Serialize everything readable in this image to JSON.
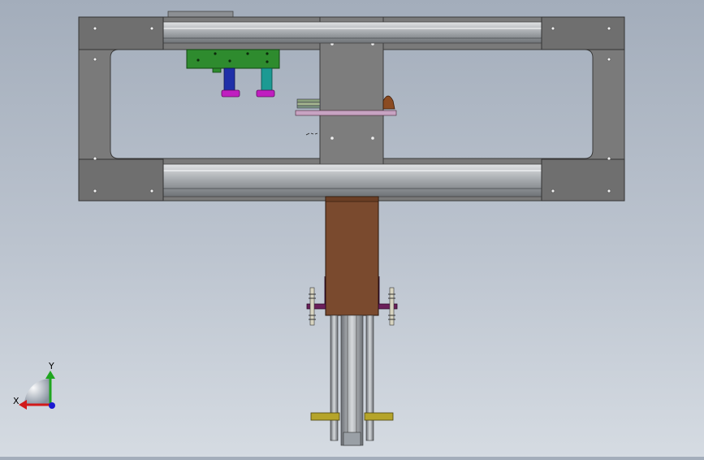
{
  "viewport": {
    "background_top": "#a3adbb",
    "background_bottom": "#d5dbe2"
  },
  "colors": {
    "frame_plate": "#7a7a7a",
    "rail": "#b9bcbf",
    "green_block": "#2e8b2e",
    "blue_rod": "#1f2fa8",
    "teal_rod": "#1c9a93",
    "magenta_pad": "#c01ec0",
    "brown_housing": "#7a4a2e",
    "purple_bracket": "#6b1f5a",
    "yellow_plate": "#b5a42a",
    "axis_x": "#d11a1a",
    "axis_y": "#1fa51f",
    "axis_z": "#1a1ad1"
  },
  "triad": {
    "x_label": "X",
    "y_label": "Y"
  },
  "icons": {
    "triad": "coordinate-triad-icon"
  }
}
